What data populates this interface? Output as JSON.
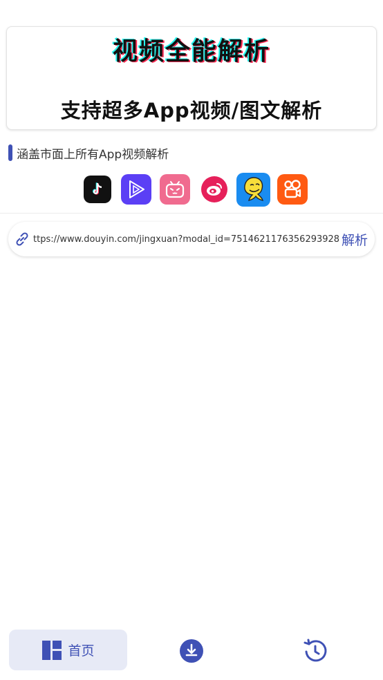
{
  "banner": {
    "title": "视频全能解析",
    "subtitle": "支持超多App视频/图文解析"
  },
  "section": {
    "title": "涵盖市面上所有App视频解析"
  },
  "apps": [
    {
      "name": "tiktok-icon",
      "color": "#000000"
    },
    {
      "name": "video-play-icon",
      "color": "#5b3ff5"
    },
    {
      "name": "bilibili-icon",
      "color": "#f06b8f"
    },
    {
      "name": "weibo-icon",
      "color": "#e6205a"
    },
    {
      "name": "qq-icon",
      "color": "#1a8cf0"
    },
    {
      "name": "kuaishou-icon",
      "color": "#ff5a12"
    }
  ],
  "url_bar": {
    "value": "ttps://www.douyin.com/jingxuan?modal_id=7514621176356293928",
    "parse_label": "解析"
  },
  "bottom_nav": {
    "home_label": "首页",
    "accent": "#3f51b5"
  }
}
